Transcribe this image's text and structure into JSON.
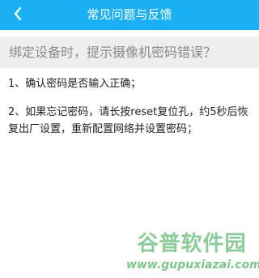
{
  "header": {
    "title": "常见问题与反馈",
    "back_icon": "chevron-left-icon"
  },
  "question": {
    "text": "绑定设备时，提示摄像机密码错误？"
  },
  "answer": {
    "items": [
      "1、确认密码是否输入正确；",
      "2、如果忘记密码，请长按reset复位孔，约5秒后恢复出厂设置，重新配置网络并设置密码；"
    ]
  },
  "watermark": {
    "brand": "谷普软件园",
    "url": "www.gupuxiazai.com"
  },
  "colors": {
    "header_bg": "#1ab0f3",
    "question_bg": "#eeeeee",
    "watermark": "#7fc68c"
  }
}
